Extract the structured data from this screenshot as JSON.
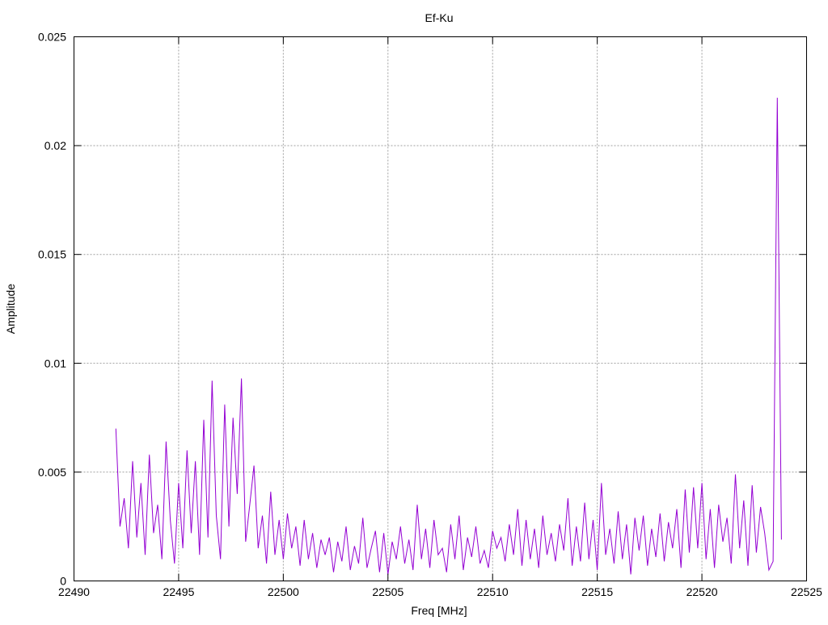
{
  "chart_data": {
    "type": "line",
    "title": "Ef-Ku",
    "xlabel": "Freq [MHz]",
    "ylabel": "Amplitude",
    "xlim": [
      22490,
      22525
    ],
    "ylim": [
      0,
      0.025
    ],
    "xticks": [
      "22490",
      "22495",
      "22500",
      "22505",
      "22510",
      "22515",
      "22520",
      "22525"
    ],
    "xtick_values": [
      22490,
      22495,
      22500,
      22505,
      22510,
      22515,
      22520,
      22525
    ],
    "yticks": [
      "0",
      "0.005",
      "0.01",
      "0.015",
      "0.02",
      "0.025"
    ],
    "ytick_values": [
      0,
      0.005,
      0.01,
      0.015,
      0.02,
      0.025
    ],
    "grid": true,
    "legend": "none",
    "series": [
      {
        "name": "Ef-Ku",
        "color": "#9400d3",
        "x_start": 22492.0,
        "x_step": 0.2,
        "values_milli": [
          7.0,
          2.5,
          3.8,
          1.5,
          5.5,
          2.0,
          4.5,
          1.2,
          5.8,
          2.2,
          3.5,
          1.0,
          6.4,
          2.8,
          0.8,
          4.5,
          1.5,
          6.0,
          2.2,
          5.5,
          1.2,
          7.4,
          2.0,
          9.2,
          3.0,
          1.0,
          8.1,
          2.5,
          7.5,
          4.0,
          9.3,
          1.8,
          3.5,
          5.3,
          1.5,
          3.0,
          0.8,
          4.1,
          1.2,
          2.8,
          1.0,
          3.1,
          1.5,
          2.5,
          0.7,
          2.8,
          1.0,
          2.2,
          0.6,
          1.9,
          1.2,
          2.0,
          0.4,
          1.8,
          0.9,
          2.5,
          0.5,
          1.6,
          0.8,
          2.9,
          0.6,
          1.5,
          2.3,
          0.4,
          2.2,
          0.3,
          1.8,
          1.0,
          2.5,
          0.8,
          1.9,
          0.5,
          3.5,
          1.0,
          2.4,
          0.6,
          2.8,
          1.2,
          1.5,
          0.4,
          2.6,
          1.0,
          3.0,
          0.5,
          2.0,
          1.1,
          2.5,
          0.8,
          1.4,
          0.6,
          2.3,
          1.5,
          2.0,
          0.9,
          2.6,
          1.2,
          3.3,
          0.7,
          2.8,
          1.0,
          2.4,
          0.6,
          3.0,
          1.2,
          2.2,
          0.9,
          2.6,
          1.4,
          3.8,
          0.7,
          2.5,
          0.9,
          3.6,
          1.0,
          2.8,
          0.5,
          4.5,
          1.2,
          2.4,
          0.8,
          3.2,
          1.0,
          2.6,
          0.3,
          2.9,
          1.4,
          3.0,
          0.7,
          2.4,
          1.1,
          3.1,
          0.9,
          2.7,
          1.5,
          3.3,
          0.6,
          4.2,
          1.3,
          4.3,
          1.5,
          4.5,
          1.0,
          3.3,
          0.6,
          3.5,
          1.8,
          2.9,
          0.8,
          4.9,
          1.5,
          3.7,
          0.7,
          4.4,
          1.3,
          3.4,
          2.2,
          0.5,
          0.9,
          22.2,
          1.9
        ]
      }
    ]
  }
}
